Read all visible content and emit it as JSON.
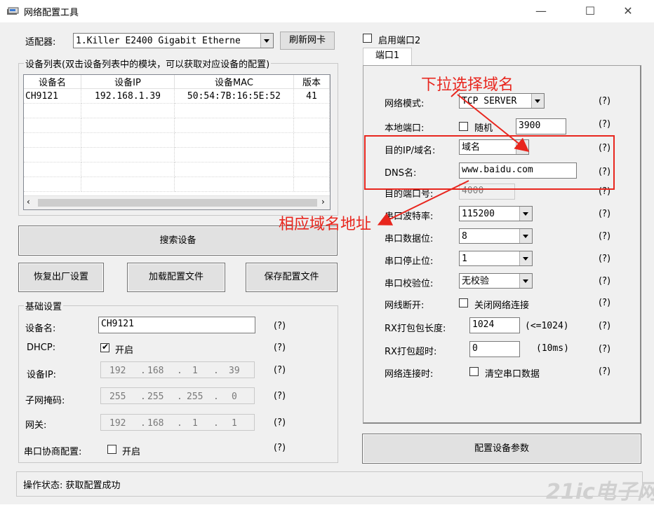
{
  "window": {
    "title": "网络配置工具"
  },
  "adapter": {
    "label": "适配器:",
    "value": "1.Killer E2400 Gigabit Etherne",
    "refresh_label": "刷新网卡"
  },
  "device_list": {
    "title": "设备列表(双击设备列表中的模块，可以获取对应设备的配置)",
    "columns": [
      "设备名",
      "设备IP",
      "设备MAC",
      "版本"
    ],
    "rows": [
      [
        "CH9121",
        "192.168.1.39",
        "50:54:7B:16:5E:52",
        "41"
      ]
    ]
  },
  "buttons": {
    "search": "搜索设备",
    "factory_reset": "恢复出厂设置",
    "load_config": "加载配置文件",
    "save_config": "保存配置文件",
    "apply_config": "配置设备参数"
  },
  "basic": {
    "title": "基础设置",
    "device_name_label": "设备名:",
    "device_name": "CH9121",
    "dhcp_label": "DHCP:",
    "dhcp_text": "开启",
    "ip_label": "设备IP:",
    "ip": [
      "192",
      "168",
      "1",
      "39"
    ],
    "mask_label": "子网掩码:",
    "mask": [
      "255",
      "255",
      "255",
      "0"
    ],
    "gateway_label": "网关:",
    "gateway": [
      "192",
      "168",
      "1",
      "1"
    ],
    "serial_neg_label": "串口协商配置:",
    "serial_neg_text": "开启",
    "help": "(?)"
  },
  "port2": {
    "label": "启用端口2"
  },
  "tab": {
    "label": "端口1"
  },
  "port1": {
    "net_mode_label": "网络模式:",
    "net_mode": "TCP SERVER",
    "local_port_label": "本地端口:",
    "random_label": "随机",
    "local_port": "3900",
    "dest_ip_label": "目的IP/域名:",
    "dest_ip_mode": "域名",
    "dns_label": "DNS名:",
    "dns": "www.baidu.com",
    "dest_port_label": "目的端口号:",
    "dest_port": "4000",
    "baud_label": "串口波特率:",
    "baud": "115200",
    "data_bits_label": "串口数据位:",
    "data_bits": "8",
    "stop_bits_label": "串口停止位:",
    "stop_bits": "1",
    "parity_label": "串口校验位:",
    "parity": "无校验",
    "disconnect_label": "网线断开:",
    "disconnect_text": "关闭网络连接",
    "rx_len_label": "RX打包包长度:",
    "rx_len": "1024",
    "rx_len_hint": "(<=1024)",
    "rx_timeout_label": "RX打包超时:",
    "rx_timeout": "0",
    "rx_timeout_unit": "(10ms)",
    "on_connect_label": "网络连接时:",
    "on_connect_text": "清空串口数据",
    "help": "(?)"
  },
  "status": {
    "text": "操作状态: 获取配置成功"
  },
  "annotations": {
    "dropdown_note": "下拉选择域名",
    "address_note": "相应域名地址"
  },
  "watermark": {
    "text": "21ic电子网"
  },
  "colors": {
    "annotation": "#e8261e",
    "window_bg": "#f0f0f0"
  }
}
